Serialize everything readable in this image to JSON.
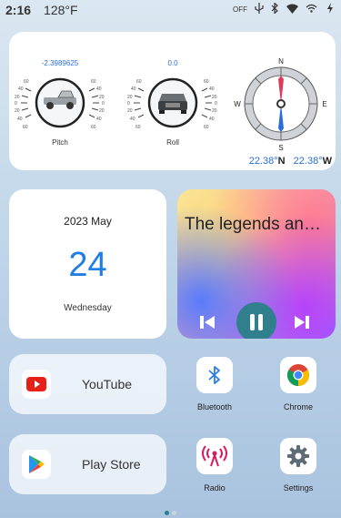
{
  "status_bar": {
    "time": "2:16",
    "temperature": "128°F",
    "indicators": [
      "OFF",
      "usb-icon",
      "bluetooth-icon",
      "wifi-icon",
      "wireless-icon",
      "battery-icon"
    ]
  },
  "gauges": {
    "pitch": {
      "value": "-2.3989625",
      "label": "Pitch",
      "ticks": [
        "60",
        "40",
        "20",
        "0",
        "20",
        "40",
        "60"
      ]
    },
    "roll": {
      "value": "0.0",
      "label": "Roll",
      "ticks": [
        "60",
        "40",
        "20",
        "0",
        "20",
        "40",
        "60"
      ]
    },
    "compass": {
      "n": "N",
      "s": "S",
      "e": "E",
      "w": "W",
      "lat_value": "22.38°",
      "lat_dir": "N",
      "lon_value": "22.38°",
      "lon_dir": "W"
    }
  },
  "date_widget": {
    "year_month": "2023 May",
    "day": "24",
    "weekday": "Wednesday"
  },
  "music_widget": {
    "title": "The legends an…"
  },
  "apps": {
    "youtube": "YouTube",
    "play_store": "Play Store",
    "bluetooth": "Bluetooth",
    "chrome": "Chrome",
    "radio": "Radio",
    "settings": "Settings"
  },
  "page_indicator": {
    "count": 2,
    "active": 0
  },
  "colors": {
    "accent": "#1e7ee6",
    "play_button": "#2f7f8d"
  }
}
